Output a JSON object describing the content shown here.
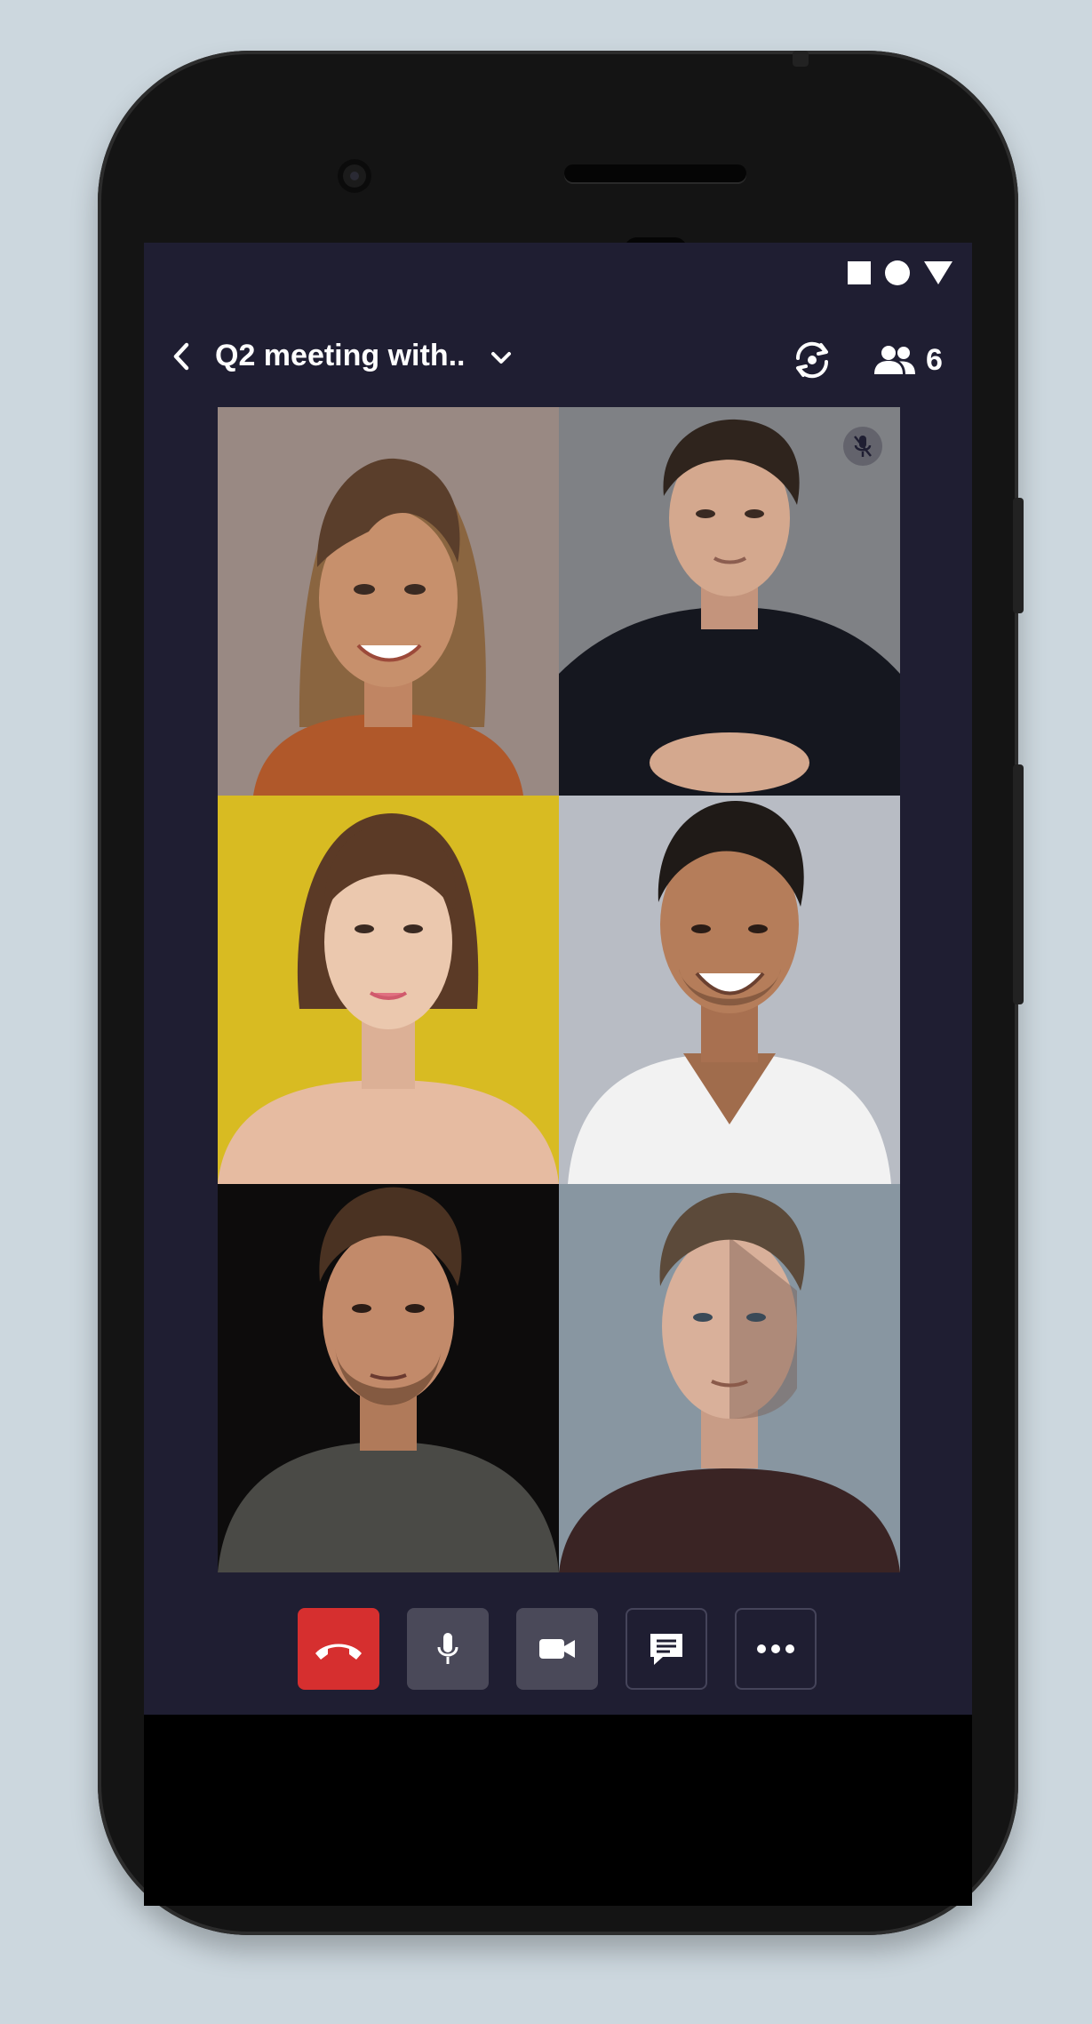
{
  "header": {
    "title": "Q2 meeting with..",
    "participant_count": "6"
  },
  "icons": {
    "back": "chevron-left-icon",
    "dropdown": "chevron-down-icon",
    "switch_camera": "switch-camera-icon",
    "participants": "people-icon",
    "mute": "mic-off-icon",
    "end_call": "phone-hangup-icon",
    "mic": "microphone-icon",
    "video": "video-camera-icon",
    "chat": "chat-icon",
    "more": "more-horizontal-icon"
  },
  "participants": [
    {
      "id": "p1",
      "muted": false,
      "background": "#9b8a80",
      "skin": "#c7906c",
      "hair": "#5a3e2b",
      "shirt": "#b0582a"
    },
    {
      "id": "p2",
      "muted": true,
      "background": "#7f8185",
      "skin": "#d4a88e",
      "hair": "#2f241d",
      "shirt": "#15171f"
    },
    {
      "id": "p3",
      "muted": false,
      "background": "#d8bb22",
      "skin": "#ebc8ae",
      "hair": "#5b3a26",
      "shirt": "#e6bba1"
    },
    {
      "id": "p4",
      "muted": false,
      "background": "#b8bcc4",
      "skin": "#b57d5a",
      "hair": "#1f1a17",
      "shirt": "#f2f2f2"
    },
    {
      "id": "p5",
      "muted": false,
      "background": "#0d0c0c",
      "skin": "#c28a6a",
      "hair": "#4a3222",
      "shirt": "#4a4a46"
    },
    {
      "id": "p6",
      "muted": false,
      "background": "#8896a1",
      "skin": "#d9b09a",
      "hair": "#5c4a3a",
      "shirt": "#3a2424"
    }
  ],
  "colors": {
    "screen_background": "#1f1e32",
    "end_call": "#d62f2f",
    "control_active": "#4a4959"
  }
}
